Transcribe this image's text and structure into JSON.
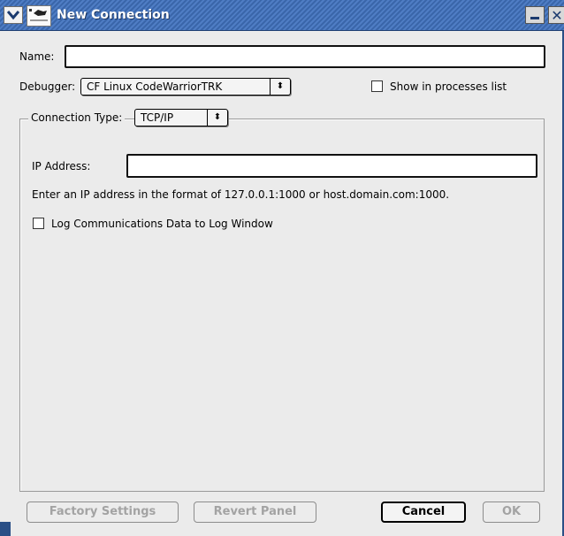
{
  "window": {
    "title": "New Connection"
  },
  "form": {
    "name_label": "Name:",
    "name_value": "",
    "debugger_label": "Debugger:",
    "debugger_selected": "CF Linux CodeWarriorTRK",
    "show_in_processes_label": "Show in processes list",
    "show_in_processes_checked": false
  },
  "connection": {
    "type_label": "Connection Type:",
    "type_selected": "TCP/IP",
    "ip_label": "IP Address:",
    "ip_value": "",
    "hint": "Enter an IP address in the format of 127.0.0.1:1000 or host.domain.com:1000.",
    "log_label": "Log Communications Data to Log Window",
    "log_checked": false
  },
  "buttons": {
    "factory_settings": "Factory Settings",
    "revert_panel": "Revert Panel",
    "cancel": "Cancel",
    "ok": "OK"
  },
  "icons": {
    "popup_arrows": "⬍"
  },
  "colors": {
    "titlebar": "#3a66aa",
    "dialog_bg": "#ebebeb",
    "disabled_text": "#a3a3a3"
  }
}
